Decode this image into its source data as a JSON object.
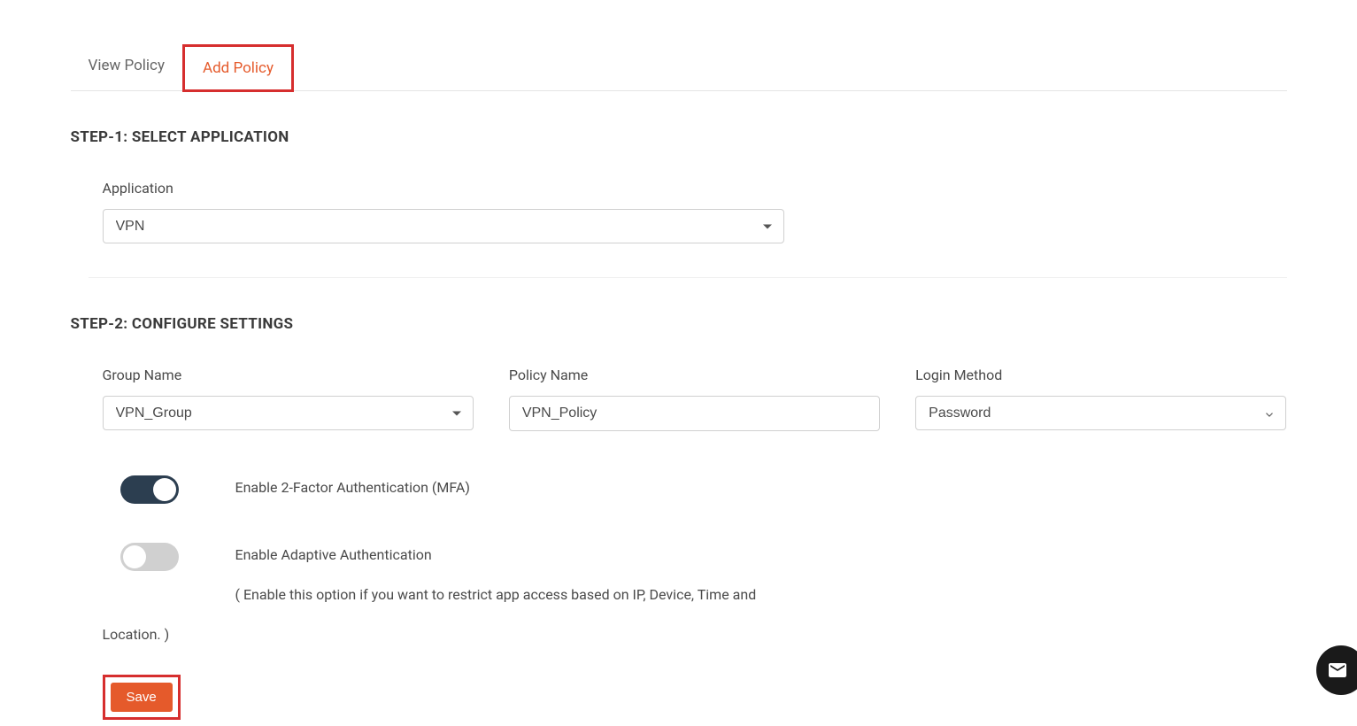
{
  "tabs": {
    "view_policy": "View Policy",
    "add_policy": "Add Policy"
  },
  "step1": {
    "heading": "STEP-1: SELECT APPLICATION",
    "application_label": "Application",
    "application_value": "VPN"
  },
  "step2": {
    "heading": "STEP-2: CONFIGURE SETTINGS",
    "group_name_label": "Group Name",
    "group_name_value": "VPN_Group",
    "policy_name_label": "Policy Name",
    "policy_name_value": "VPN_Policy",
    "login_method_label": "Login Method",
    "login_method_value": "Password",
    "mfa_label": "Enable 2-Factor Authentication (MFA)",
    "adaptive_label": "Enable Adaptive Authentication",
    "adaptive_description": "( Enable this option if you want to restrict app access based on IP, Device, Time and",
    "adaptive_description_cont": "Location. )"
  },
  "actions": {
    "save": "Save"
  }
}
